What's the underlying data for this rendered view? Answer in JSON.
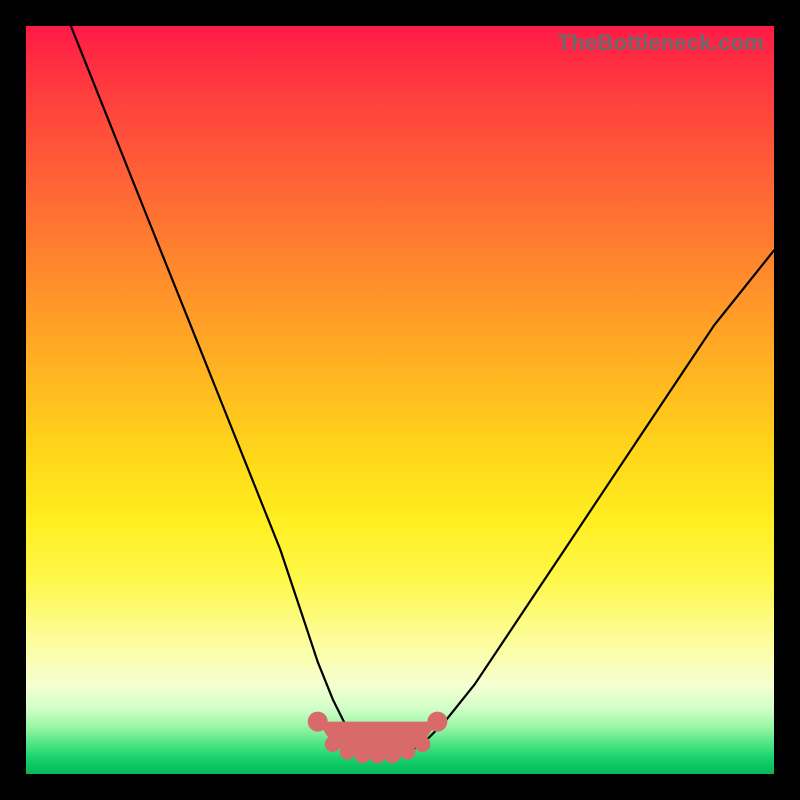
{
  "watermark": "TheBottleneck.com",
  "colors": {
    "page_bg": "#000000",
    "gradient_top": "#ff1a47",
    "gradient_bottom": "#06b858",
    "curve": "#000000",
    "marker": "#d86a6a"
  },
  "chart_data": {
    "type": "line",
    "title": "",
    "xlabel": "",
    "ylabel": "",
    "xlim": [
      0,
      100
    ],
    "ylim": [
      0,
      100
    ],
    "grid": false,
    "legend": false,
    "note": "Axes are normalized 0–100; no tick labels are visible in the image. Values are estimated from pixel positions.",
    "series": [
      {
        "name": "bottleneck-curve",
        "x": [
          6,
          10,
          14,
          18,
          22,
          26,
          30,
          34,
          37,
          39,
          41,
          43,
          45,
          47,
          49,
          51,
          53,
          56,
          60,
          64,
          68,
          72,
          76,
          80,
          84,
          88,
          92,
          96,
          100
        ],
        "y": [
          100,
          90,
          80,
          70,
          60,
          50,
          40,
          30,
          21,
          15,
          10,
          6,
          4,
          3,
          3,
          3,
          4,
          7,
          12,
          18,
          24,
          30,
          36,
          42,
          48,
          54,
          60,
          65,
          70
        ]
      }
    ],
    "markers": {
      "name": "optimal-range",
      "x": [
        39,
        41,
        43,
        45,
        47,
        49,
        51,
        53,
        55
      ],
      "y": [
        7,
        4,
        3,
        2.5,
        2.5,
        2.5,
        3,
        4,
        7
      ]
    }
  }
}
